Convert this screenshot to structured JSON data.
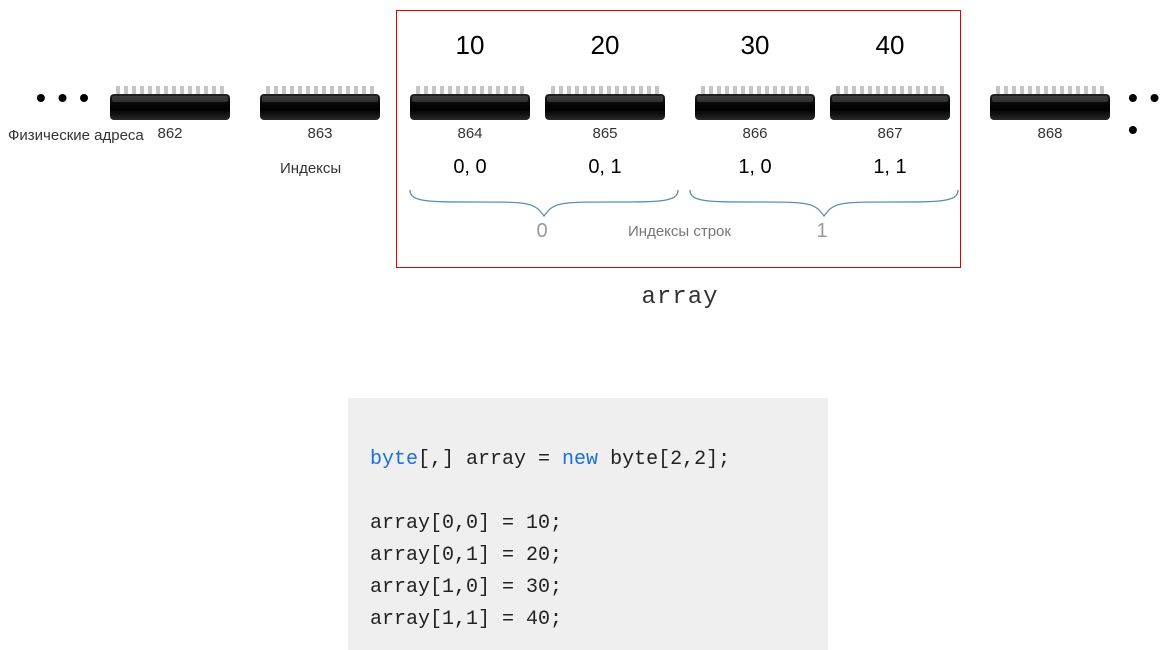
{
  "dots": "• • •",
  "labels": {
    "physical_addresses": "Физические адреса",
    "indices": "Индексы",
    "row_indices": "Индексы строк",
    "array_name": "array"
  },
  "cells": [
    {
      "addr": "862"
    },
    {
      "addr": "863"
    },
    {
      "addr": "864",
      "value": "10",
      "idx2d": "0, 0"
    },
    {
      "addr": "865",
      "value": "20",
      "idx2d": "0, 1"
    },
    {
      "addr": "866",
      "value": "30",
      "idx2d": "1, 0"
    },
    {
      "addr": "867",
      "value": "40",
      "idx2d": "1, 1"
    },
    {
      "addr": "868"
    }
  ],
  "row_groups": [
    {
      "label": "0"
    },
    {
      "label": "1"
    }
  ],
  "code": {
    "type_kw": "byte",
    "decl_rest": "[,] array = ",
    "new_kw": "new",
    "decl_tail": " byte[2,2];",
    "lines": [
      "array[0,0] = 10;",
      "array[0,1] = 20;",
      "array[1,0] = 30;",
      "array[1,1] = 40;"
    ]
  }
}
